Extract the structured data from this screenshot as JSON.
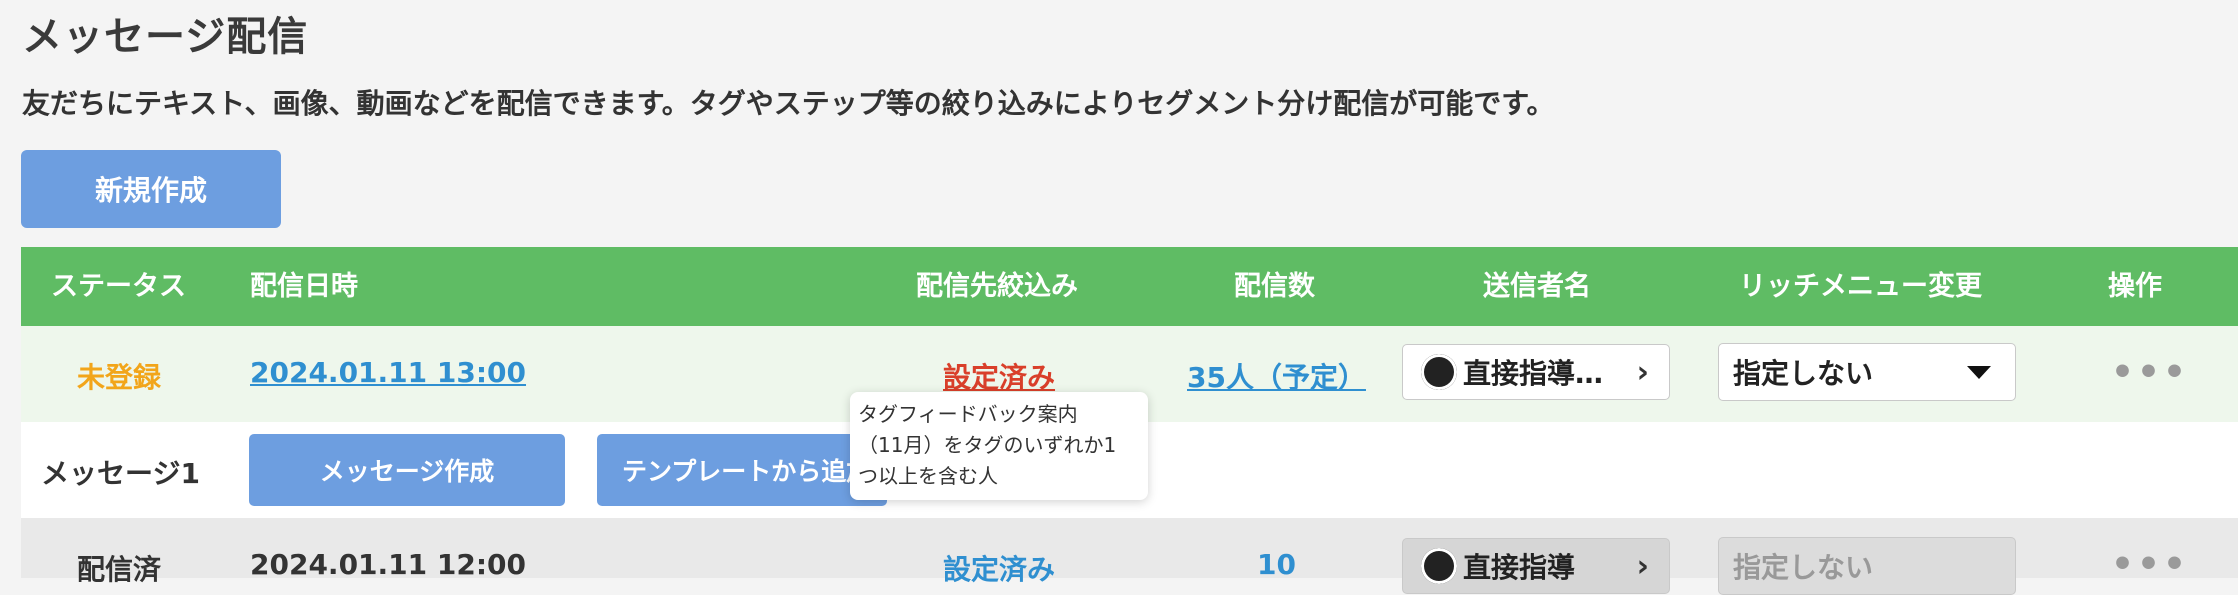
{
  "page": {
    "title": "メッセージ配信",
    "description": "友だちにテキスト、画像、動画などを配信できます。タグやステップ等の絞り込みによりセグメント分け配信が可能です。",
    "new_button": "新規作成"
  },
  "table": {
    "headers": {
      "status": "ステータス",
      "datetime": "配信日時",
      "filter": "配信先絞込み",
      "count": "配信数",
      "sender": "送信者名",
      "richmenu": "リッチメニュー変更",
      "actions": "操作"
    },
    "rows": [
      {
        "status": "未登録",
        "datetime": "2024.01.11 13:00",
        "filter": "設定済み",
        "count": "35人（予定）",
        "sender": "直接指導…",
        "richmenu": "指定しない",
        "actions": "•••"
      },
      {
        "status": "配信済",
        "datetime": "2024.01.11 12:00",
        "filter": "設定済み",
        "count": "10",
        "sender": "直接指導",
        "richmenu": "指定しない",
        "actions": "•••"
      }
    ],
    "message_row": {
      "label": "メッセージ1",
      "create_button": "メッセージ作成",
      "template_button": "テンプレートから追加"
    }
  },
  "tooltip": {
    "lines": [
      "タグフィードバック案内",
      "（11月）をタグのいずれか1",
      "つ以上を含む人"
    ]
  },
  "colors": {
    "header_green": "#5fbc64",
    "button_blue": "#6d9ee0",
    "status_unregistered": "#f2a51a",
    "link_blue": "#2f8fd0",
    "filter_red": "#d93f2a"
  },
  "icons": {
    "sender_avatar": "avatar-icon",
    "sender_chevron": "chevron-right-icon",
    "select_caret": "caret-down-icon",
    "actions": "more-horizontal-icon"
  }
}
